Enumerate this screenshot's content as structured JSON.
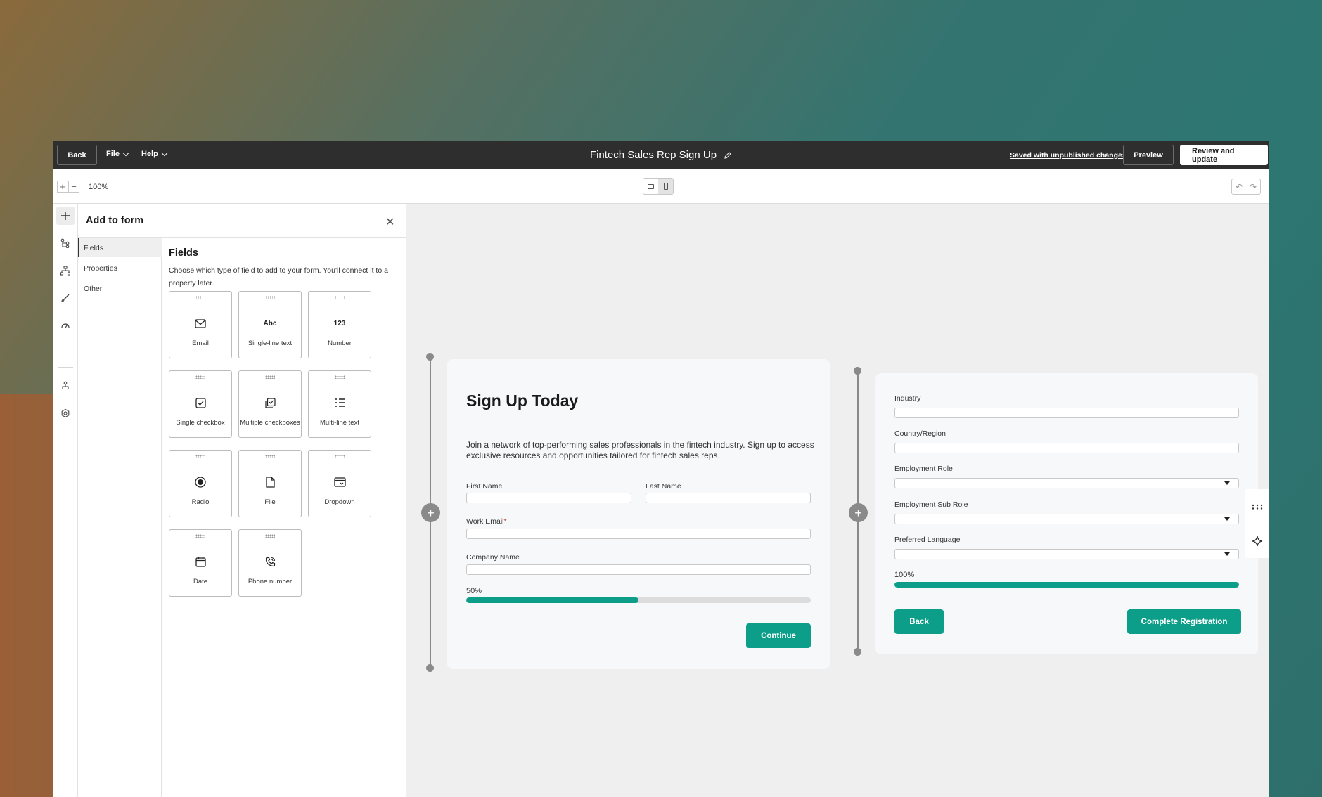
{
  "topbar": {
    "back_label": "Back",
    "file_label": "File",
    "help_label": "Help",
    "title": "Fintech Sales Rep Sign Up",
    "saved_status": "Saved with unpublished changes",
    "preview_label": "Preview",
    "review_label": "Review and update"
  },
  "toolbar": {
    "zoom_in": "+",
    "zoom_out": "−",
    "zoom_level": "100%",
    "undo": "↶",
    "redo": "↷"
  },
  "panel": {
    "title": "Add to form",
    "close": "✕",
    "nav": [
      "Fields",
      "Properties",
      "Other"
    ],
    "active_nav": "Fields",
    "section_title": "Fields",
    "description": "Choose which type of field to add to your form. You'll connect it to a property later.",
    "tiles": [
      {
        "label": "Email",
        "icon": "email-icon"
      },
      {
        "label": "Single-line text",
        "icon": "abc-icon",
        "glyph": "Abc"
      },
      {
        "label": "Number",
        "icon": "number-icon",
        "glyph": "123"
      },
      {
        "label": "Single checkbox",
        "icon": "checkbox-icon"
      },
      {
        "label": "Multiple checkboxes",
        "icon": "multi-checkbox-icon"
      },
      {
        "label": "Multi-line text",
        "icon": "multiline-icon"
      },
      {
        "label": "Radio",
        "icon": "radio-icon"
      },
      {
        "label": "File",
        "icon": "file-icon"
      },
      {
        "label": "Dropdown",
        "icon": "dropdown-icon"
      },
      {
        "label": "Date",
        "icon": "calendar-icon"
      },
      {
        "label": "Phone number",
        "icon": "phone-icon"
      }
    ]
  },
  "step1": {
    "title": "Sign Up Today",
    "description": "Join a network of top-performing sales professionals in the fintech industry. Sign up to access exclusive resources and opportunities tailored for fintech sales reps.",
    "first_name_label": "First Name",
    "last_name_label": "Last Name",
    "work_email_label": "Work Email",
    "required_mark": "*",
    "company_label": "Company Name",
    "progress_text": "50%",
    "progress": 0.5,
    "continue_label": "Continue"
  },
  "step2": {
    "industry_label": "Industry",
    "country_label": "Country/Region",
    "role_label": "Employment Role",
    "sub_role_label": "Employment Sub Role",
    "language_label": "Preferred Language",
    "progress_text": "100%",
    "progress": 1.0,
    "back_label": "Back",
    "complete_label": "Complete Registration"
  },
  "colors": {
    "accent": "#0d9e8a",
    "topbar": "#2e2e2e",
    "canvas": "#efefef"
  }
}
